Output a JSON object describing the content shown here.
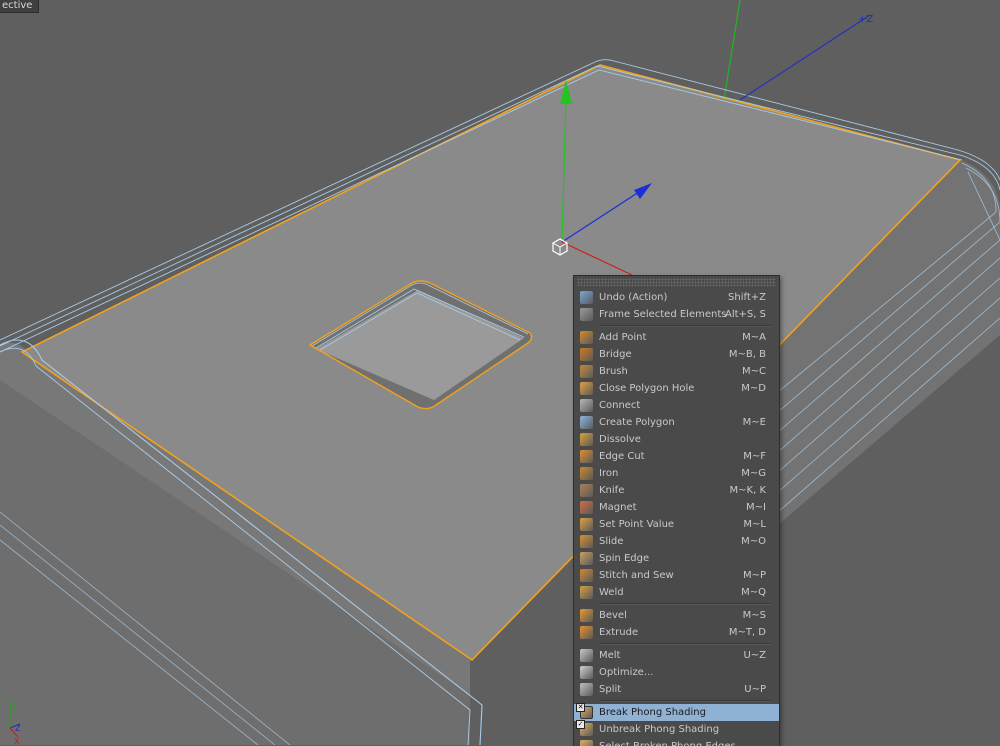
{
  "viewport": {
    "title": "ective",
    "colors": {
      "background": "#5f5f5f",
      "model_face": "#8a8a8a",
      "selection_outline": "#f2a21b",
      "wireframe": "#a9cce8",
      "y_axis": "#22c422",
      "z_axis": "#1d2ed8",
      "x_axis": "#d01e1e"
    },
    "icons": {
      "move_y_handle": "green-cone-arrow-icon",
      "move_z_handle": "blue-cone-arrow-icon",
      "axis_origin": "axis-origin-cube-icon",
      "world_axis": "world-axis-gizmo-icon"
    }
  },
  "context_menu": {
    "groups": [
      {
        "items": [
          {
            "label": "Undo (Action)",
            "shortcut": "Shift+Z",
            "icon": "undo-icon",
            "color": "#7aa6d6"
          },
          {
            "label": "Frame Selected Elements",
            "shortcut": "Alt+S, S",
            "icon": "frame-icon",
            "color": "#9a9a9a"
          }
        ]
      },
      {
        "items": [
          {
            "label": "Add Point",
            "shortcut": "M~A",
            "icon": "add-point-icon",
            "color": "#d58a2a"
          },
          {
            "label": "Bridge",
            "shortcut": "M~B, B",
            "icon": "bridge-icon",
            "color": "#d07a1f"
          },
          {
            "label": "Brush",
            "shortcut": "M~C",
            "icon": "brush-icon",
            "color": "#c78a3c"
          },
          {
            "label": "Close Polygon Hole",
            "shortcut": "M~D",
            "icon": "close-hole-icon",
            "color": "#e3a040"
          },
          {
            "label": "Connect",
            "shortcut": "",
            "icon": "connect-icon",
            "color": "#b8b8b8"
          },
          {
            "label": "Create Polygon",
            "shortcut": "M~E",
            "icon": "create-polygon-icon",
            "color": "#8fb5e0"
          },
          {
            "label": "Dissolve",
            "shortcut": "",
            "icon": "dissolve-icon",
            "color": "#d9a33a"
          },
          {
            "label": "Edge Cut",
            "shortcut": "M~F",
            "icon": "edge-cut-icon",
            "color": "#e09030"
          },
          {
            "label": "Iron",
            "shortcut": "M~G",
            "icon": "iron-icon",
            "color": "#c98a2c"
          },
          {
            "label": "Knife",
            "shortcut": "M~K, K",
            "icon": "knife-icon",
            "color": "#b08050"
          },
          {
            "label": "Magnet",
            "shortcut": "M~I",
            "icon": "magnet-icon",
            "color": "#d07040"
          },
          {
            "label": "Set Point Value",
            "shortcut": "M~L",
            "icon": "set-point-value-icon",
            "color": "#e0a040"
          },
          {
            "label": "Slide",
            "shortcut": "M~O",
            "icon": "slide-icon",
            "color": "#d99030"
          },
          {
            "label": "Spin Edge",
            "shortcut": "",
            "icon": "spin-edge-icon",
            "color": "#c8a060"
          },
          {
            "label": "Stitch and Sew",
            "shortcut": "M~P",
            "icon": "stitch-sew-icon",
            "color": "#d08a30"
          },
          {
            "label": "Weld",
            "shortcut": "M~Q",
            "icon": "weld-icon",
            "color": "#d0a040"
          }
        ]
      },
      {
        "items": [
          {
            "label": "Bevel",
            "shortcut": "M~S",
            "icon": "bevel-icon",
            "color": "#e89a2c"
          },
          {
            "label": "Extrude",
            "shortcut": "M~T, D",
            "icon": "extrude-icon",
            "color": "#e8902a"
          }
        ]
      },
      {
        "items": [
          {
            "label": "Melt",
            "shortcut": "U~Z",
            "icon": "melt-icon",
            "color": "#c8c8c8"
          },
          {
            "label": "Optimize...",
            "shortcut": "",
            "icon": "optimize-icon",
            "color": "#d0d0d0"
          },
          {
            "label": "Split",
            "shortcut": "U~P",
            "icon": "split-icon",
            "color": "#c0c0c0"
          }
        ]
      },
      {
        "items": [
          {
            "label": "Break Phong Shading",
            "shortcut": "",
            "icon": "break-phong-icon",
            "color": "#e0b060",
            "highlighted": true,
            "checkbox": "✕"
          },
          {
            "label": "Unbreak Phong Shading",
            "shortcut": "",
            "icon": "unbreak-phong-icon",
            "color": "#e0b060",
            "checkbox": "✓"
          },
          {
            "label": "Select Broken Phong Edges",
            "shortcut": "",
            "icon": "select-broken-phong-icon",
            "color": "#e0b060"
          }
        ]
      }
    ]
  }
}
